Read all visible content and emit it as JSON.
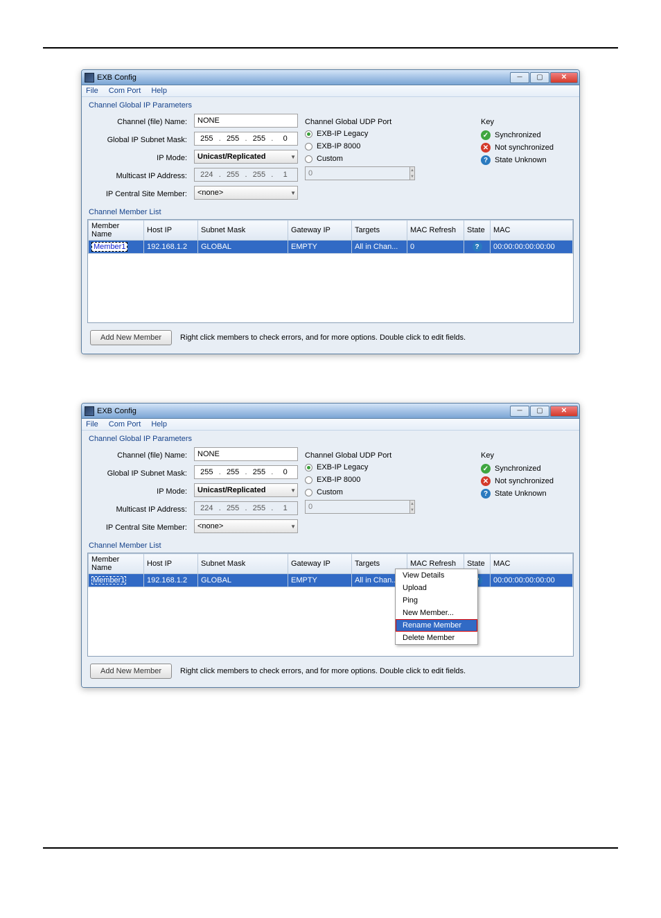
{
  "window": {
    "title": "EXB Config",
    "menu": {
      "file": "File",
      "com_port": "Com Port",
      "help": "Help"
    }
  },
  "sections": {
    "global_params": "Channel Global IP Parameters",
    "member_list": "Channel Member List"
  },
  "labels": {
    "channel_name": "Channel (file) Name:",
    "subnet": "Global IP Subnet Mask:",
    "ip_mode": "IP Mode:",
    "multicast": "Multicast IP Address:",
    "central_member": "IP Central Site Member:"
  },
  "values": {
    "channel_name": "NONE",
    "subnet": [
      "255",
      "255",
      "255",
      "0"
    ],
    "ip_mode": "Unicast/Replicated",
    "multicast": [
      "224",
      "255",
      "255",
      "1"
    ],
    "central_member": "<none>"
  },
  "udp": {
    "title": "Channel Global UDP Port",
    "opt1": "EXB-IP Legacy",
    "opt2": "EXB-IP 8000",
    "opt3": "Custom",
    "custom_value": "0"
  },
  "key": {
    "title": "Key",
    "sync": "Synchronized",
    "nosync": "Not synchronized",
    "unknown": "State Unknown"
  },
  "table": {
    "headers": {
      "member_name": "Member Name",
      "host_ip": "Host IP",
      "subnet_mask": "Subnet Mask",
      "gateway_ip": "Gateway IP",
      "targets": "Targets",
      "mac_refresh": "MAC Refresh",
      "state": "State",
      "mac": "MAC"
    },
    "row": {
      "member_name": "Member1",
      "host_ip": "192.168.1.2",
      "subnet_mask": "GLOBAL",
      "gateway_ip": "EMPTY",
      "targets": "All in Chan...",
      "mac_refresh": "0",
      "mac": "00:00:00:00:00:00"
    }
  },
  "footer": {
    "add_btn": "Add New Member",
    "hint": "Right click members to check errors, and for more options.  Double click to edit fields."
  },
  "context_menu": {
    "view_details": "View Details",
    "upload": "Upload",
    "ping": "Ping",
    "new_member": "New Member...",
    "rename_member": "Rename Member",
    "delete_member": "Delete Member"
  }
}
